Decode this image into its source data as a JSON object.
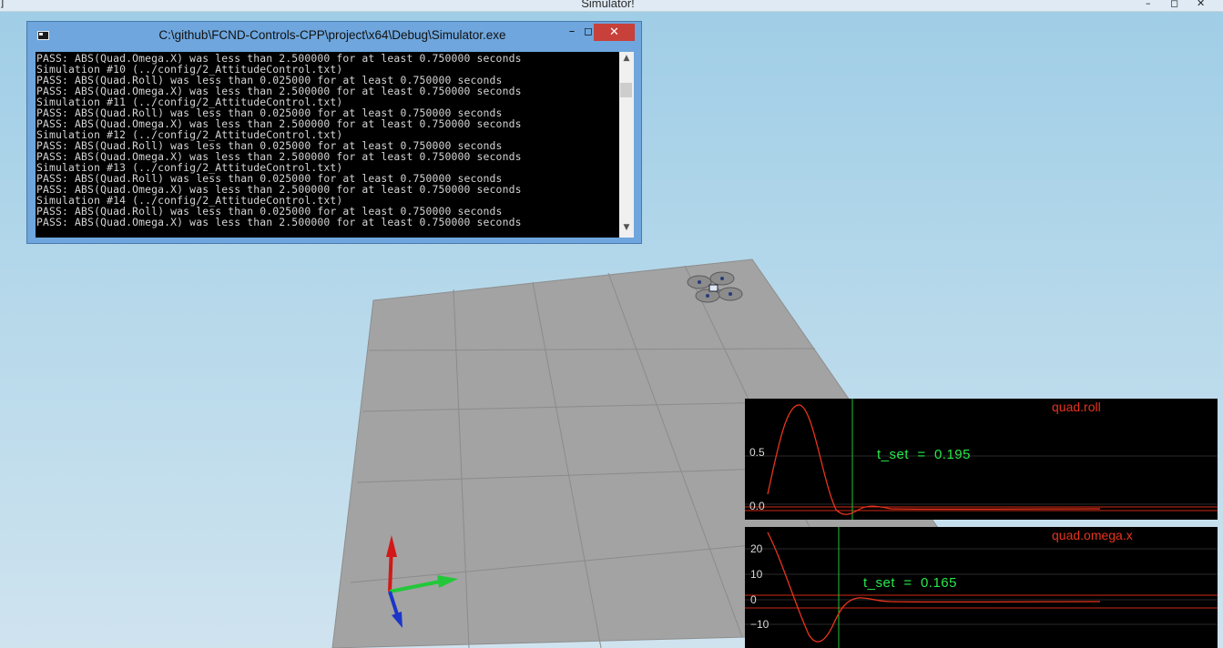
{
  "window": {
    "title": "Simulator!",
    "left_edge_glyph": "]",
    "controls": {
      "minimize": "–",
      "maximize": "◻",
      "close": "✕"
    }
  },
  "console": {
    "title": "C:\\github\\FCND-Controls-CPP\\project\\x64\\Debug\\Simulator.exe",
    "icon": "console-app-icon",
    "controls": {
      "minimize": "–",
      "maximize": "◻",
      "close": "✕"
    },
    "lines": [
      "PASS: ABS(Quad.Omega.X) was less than 2.500000 for at least 0.750000 seconds",
      "Simulation #10 (../config/2_AttitudeControl.txt)",
      "PASS: ABS(Quad.Roll) was less than 0.025000 for at least 0.750000 seconds",
      "PASS: ABS(Quad.Omega.X) was less than 2.500000 for at least 0.750000 seconds",
      "Simulation #11 (../config/2_AttitudeControl.txt)",
      "PASS: ABS(Quad.Roll) was less than 0.025000 for at least 0.750000 seconds",
      "PASS: ABS(Quad.Omega.X) was less than 2.500000 for at least 0.750000 seconds",
      "Simulation #12 (../config/2_AttitudeControl.txt)",
      "PASS: ABS(Quad.Roll) was less than 0.025000 for at least 0.750000 seconds",
      "PASS: ABS(Quad.Omega.X) was less than 2.500000 for at least 0.750000 seconds",
      "Simulation #13 (../config/2_AttitudeControl.txt)",
      "PASS: ABS(Quad.Roll) was less than 0.025000 for at least 0.750000 seconds",
      "PASS: ABS(Quad.Omega.X) was less than 2.500000 for at least 0.750000 seconds",
      "Simulation #14 (../config/2_AttitudeControl.txt)",
      "PASS: ABS(Quad.Roll) was less than 0.025000 for at least 0.750000 seconds",
      "PASS: ABS(Quad.Omega.X) was less than 2.500000 for at least 0.750000 seconds"
    ],
    "scroll": {
      "up": "▲",
      "down": "▼"
    }
  },
  "graphs": [
    {
      "title": "quad.roll",
      "y_labels": [
        "0.5",
        "0.0"
      ],
      "annotation": "t_set  =  0.195",
      "line_color": "#e8341c",
      "marker_color": "#1fc437"
    },
    {
      "title": "quad.omega.x",
      "y_labels": [
        "20",
        "10",
        "0",
        "−10"
      ],
      "annotation": "t_set  =  0.165",
      "line_color": "#e8341c",
      "marker_color": "#1fc437"
    }
  ],
  "colors": {
    "sky_top": "#9fcde6",
    "floor": "#a5a5a5",
    "axis_x": "#22c83a",
    "axis_y": "#d21818",
    "axis_z": "#1c36c8"
  }
}
